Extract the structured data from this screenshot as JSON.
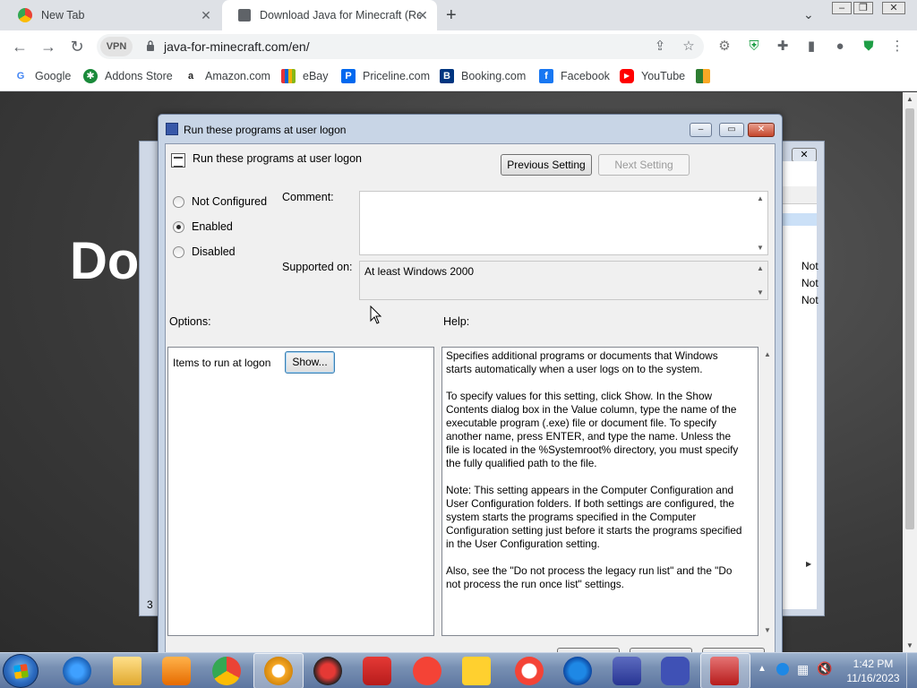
{
  "browser": {
    "tabs": [
      {
        "title": "New Tab"
      },
      {
        "title": "Download Java for Minecraft (Re"
      }
    ],
    "vpn_label": "VPN",
    "url": "java-for-minecraft.com/en/",
    "bookmarks": [
      {
        "label": "Google",
        "color": "#4285f4",
        "glyph": "G"
      },
      {
        "label": "Addons Store",
        "color": "#1a8a3a",
        "glyph": "✱"
      },
      {
        "label": "Amazon.com",
        "color": "#222222",
        "glyph": "a"
      },
      {
        "label": "eBay",
        "color": "#e53238",
        "glyph": "e"
      },
      {
        "label": "Priceline.com",
        "color": "#0068ef",
        "glyph": "P"
      },
      {
        "label": "Booking.com",
        "color": "#003580",
        "glyph": "B."
      },
      {
        "label": "Facebook",
        "color": "#1877f2",
        "glyph": "f"
      },
      {
        "label": "YouTube",
        "color": "#ff0000",
        "glyph": "▶"
      }
    ]
  },
  "page": {
    "hero_text": "Do",
    "bg_window": {
      "cells": [
        "Not",
        "Not",
        "Not"
      ],
      "status": "3"
    }
  },
  "dialog": {
    "title": "Run these programs at user logon",
    "setting_name": "Run these programs at user logon",
    "previous_button": "Previous Setting",
    "next_button": "Next Setting",
    "radios": [
      {
        "label": "Not Configured",
        "checked": false
      },
      {
        "label": "Enabled",
        "checked": true
      },
      {
        "label": "Disabled",
        "checked": false
      }
    ],
    "comment_label": "Comment:",
    "comment_value": "",
    "supported_label": "Supported on:",
    "supported_value": "At least Windows 2000",
    "options_label": "Options:",
    "help_label": "Help:",
    "option_item_label": "Items to run at logon",
    "show_button": "Show...",
    "help_text": "Specifies additional programs or documents that Windows starts automatically when a user logs on to the system.\n\nTo specify values for this setting, click Show. In the Show Contents dialog box in the Value column, type the name of the executable program (.exe) file or document file. To specify another name, press ENTER, and type the name. Unless the file is located in the %Systemroot% directory, you must specify the fully qualified path to the file.\n\nNote: This setting appears in the Computer Configuration and User Configuration folders. If both settings are configured, the system starts the programs specified in the Computer Configuration setting just before it starts the programs specified in the User Configuration setting.\n\nAlso, see the \"Do not process the legacy run list\" and the \"Do not process the run once list\" settings."
  },
  "taskbar": {
    "time": "1:42 PM",
    "date": "11/16/2023",
    "apps": [
      "internet-explorer",
      "file-explorer",
      "media-player",
      "chrome",
      "opera-vpn",
      "unknown-red",
      "screen-recorder",
      "yandex",
      "miro",
      "yandex-browser",
      "ccleaner",
      "app-switcher",
      "pricing-app",
      "toolbox"
    ]
  }
}
